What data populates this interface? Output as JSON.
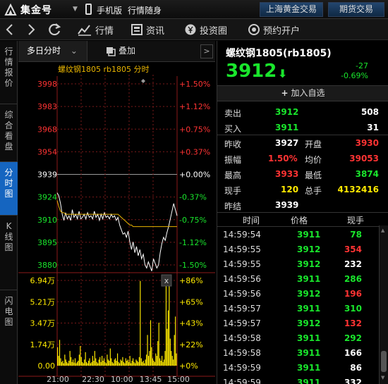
{
  "app": {
    "logo_text": "集金号",
    "mobile_label": "手机版",
    "market_label": "行情随身",
    "tabs": [
      "上海黄金交易",
      "期货交易"
    ]
  },
  "toolbar": {
    "quotes": "行情",
    "news": "资讯",
    "invest": "投资圈",
    "open_account": "预约开户"
  },
  "side_tabs": [
    "行情报价",
    "综合看盘",
    "分时图",
    "K线图",
    "闪电图"
  ],
  "chart_tabs": {
    "multiday": "多日分时",
    "overlay": "叠加"
  },
  "chart_header": "螺纹钢1805 rb1805 分时",
  "symbol": {
    "title": "螺纹钢1805(rb1805)",
    "price": "3912",
    "change": "-27",
    "change_pct": "-0.69%",
    "add_watch": "加入自选"
  },
  "quote": {
    "sell_label": "卖出",
    "sell_price": "3912",
    "sell_vol": "508",
    "buy_label": "买入",
    "buy_price": "3911",
    "buy_vol": "31",
    "prev_close_label": "昨收",
    "prev_close": "3927",
    "open_label": "开盘",
    "open": "3930",
    "amplitude_label": "振幅",
    "amplitude": "1.50%",
    "avg_label": "均价",
    "avg": "39053",
    "high_label": "最高",
    "high": "3933",
    "low_label": "最低",
    "low": "3874",
    "last_vol_label": "现手",
    "last_vol": "120",
    "total_vol_label": "总手",
    "total_vol": "4132416",
    "prev_settle_label": "昨结",
    "prev_settle": "3939"
  },
  "trades_header": {
    "time": "时间",
    "price": "价格",
    "vol": "现手"
  },
  "trades": [
    {
      "time": "14:59:54",
      "price": "3911",
      "vol": "78",
      "color": "#19e62c"
    },
    {
      "time": "14:59:55",
      "price": "3912",
      "vol": "354",
      "color": "#ff3333"
    },
    {
      "time": "14:59:55",
      "price": "3912",
      "vol": "232",
      "color": "#ffffff"
    },
    {
      "time": "14:59:56",
      "price": "3911",
      "vol": "286",
      "color": "#19e62c"
    },
    {
      "time": "14:59:56",
      "price": "3912",
      "vol": "196",
      "color": "#ff3333"
    },
    {
      "time": "14:59:57",
      "price": "3911",
      "vol": "310",
      "color": "#19e62c"
    },
    {
      "time": "14:59:57",
      "price": "3912",
      "vol": "132",
      "color": "#ff3333"
    },
    {
      "time": "14:59:58",
      "price": "3911",
      "vol": "292",
      "color": "#19e62c"
    },
    {
      "time": "14:59:58",
      "price": "3911",
      "vol": "166",
      "color": "#ffffff"
    },
    {
      "time": "14:59:59",
      "price": "3911",
      "vol": "86",
      "color": "#ffffff"
    },
    {
      "time": "14:59:59",
      "price": "3911",
      "vol": "332",
      "color": "#ffffff"
    }
  ],
  "colors": {
    "up": "#ff3333",
    "down": "#19e62c",
    "neutral": "#ffffff",
    "avg_line": "#e8b400",
    "volume": "#ffea00",
    "accent": "#1565c0"
  },
  "chart_data": [
    {
      "type": "line",
      "title": "螺纹钢1805 rb1805 分时",
      "price_ticks": [
        "3998",
        "3983",
        "3968",
        "3954",
        "3939",
        "3924",
        "3910",
        "3895",
        "3880"
      ],
      "pct_ticks": [
        "+1.50%",
        "+1.12%",
        "+0.75%",
        "+0.37%",
        "+0.00%",
        "-0.37%",
        "-0.75%",
        "-1.12%",
        "-1.50%"
      ],
      "ylim": [
        3880,
        3998
      ],
      "x_ticks": [
        "21:00",
        "22:30",
        "10:00",
        "13:45",
        "15:00"
      ],
      "series": [
        {
          "values": [
            3927,
            3925,
            3920,
            3913,
            3909,
            3914,
            3910,
            3912,
            3909,
            3916,
            3911,
            3913,
            3910,
            3915,
            3910,
            3911,
            3913,
            3910,
            3914,
            3911,
            3912,
            3910,
            3915,
            3911,
            3913,
            3909,
            3913,
            3910,
            3914,
            3911,
            3912,
            3910,
            3913,
            3911,
            3912,
            3909,
            3911,
            3906,
            3903,
            3900,
            3901,
            3898,
            3902,
            3895,
            3890,
            3895,
            3888,
            3892,
            3886,
            3890,
            3884,
            3887,
            3880,
            3878,
            3882,
            3879,
            3876,
            3884,
            3881,
            3878,
            3880,
            3888,
            3894,
            3898,
            3896,
            3901,
            3905,
            3910,
            3915,
            3920,
            3916,
            3912
          ]
        },
        {
          "values": [
            3922,
            3918,
            3915,
            3914,
            3914,
            3913,
            3913,
            3913,
            3913,
            3913,
            3913,
            3913,
            3913,
            3913,
            3913,
            3913,
            3913,
            3913,
            3913,
            3913,
            3913,
            3913,
            3913,
            3913,
            3913,
            3913,
            3913,
            3913,
            3913,
            3913,
            3913,
            3913,
            3913,
            3913,
            3913,
            3913,
            3913,
            3912,
            3911,
            3910,
            3909,
            3908,
            3907,
            3906,
            3906,
            3905,
            3905,
            3905,
            3905,
            3905,
            3905,
            3905,
            3905,
            3905,
            3905,
            3905,
            3905,
            3905,
            3905,
            3905,
            3905,
            3905,
            3905,
            3905,
            3905,
            3905,
            3905,
            3905,
            3905,
            3905,
            3905,
            3905
          ]
        }
      ]
    },
    {
      "type": "bar",
      "vol_ticks": [
        "6.94万",
        "5.21万",
        "3.47万",
        "1.74万",
        "0.00"
      ],
      "pct_ticks": [
        "+86%",
        "+65%",
        "+43%",
        "+22%",
        "+0%"
      ],
      "ylim": [
        0,
        69400
      ],
      "values": [
        15000,
        8000,
        21000,
        6000,
        3000,
        4000,
        2000,
        9000,
        5000,
        3000,
        2000,
        4000,
        12000,
        7000,
        3000,
        5000,
        2500,
        6000,
        2000,
        3000,
        4000,
        9000,
        16000,
        7000,
        3000,
        2000,
        5000,
        11000,
        3000,
        2000,
        4000,
        6000,
        2000,
        3000,
        8000,
        4000,
        12000,
        6000,
        3000,
        2000,
        5000,
        7000,
        3000,
        8000,
        4000,
        6000,
        3000,
        2000,
        9000,
        5000,
        4000,
        14000,
        6000,
        3000,
        2000,
        5000,
        6000,
        4000,
        10000,
        3000,
        2000,
        5000,
        4000,
        7000,
        3000,
        2000,
        6000,
        4000,
        5000,
        3000,
        8000,
        2000,
        4000,
        6000,
        3000,
        2000,
        5000,
        4000,
        3000,
        7000,
        69000,
        6000,
        3000,
        4000,
        2000,
        5000,
        9000,
        25000,
        8000,
        12000,
        37000,
        15000,
        6000,
        4000,
        3000,
        10000,
        8000,
        20000,
        35000,
        6000,
        4000,
        8000,
        3000,
        5000,
        12000,
        69000,
        30000,
        45000,
        69000,
        22000,
        12000,
        8000,
        5000,
        25000,
        40000,
        10000
      ]
    }
  ]
}
